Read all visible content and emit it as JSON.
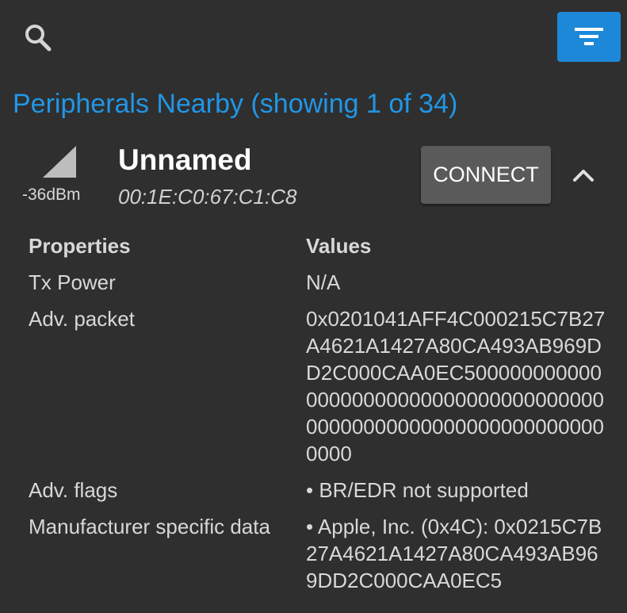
{
  "colors": {
    "background": "#2f2f2f",
    "accent": "#2196e6",
    "filter_button": "#1e88d8",
    "connect_button": "#5a5a5a"
  },
  "toolbar": {
    "search_icon": "search-icon",
    "filter_icon": "filter-icon"
  },
  "section_title": "Peripherals Nearby (showing 1 of 34)",
  "device": {
    "signal_icon": "signal-strength-icon",
    "rssi": "-36dBm",
    "name": "Unnamed",
    "address": "00:1E:C0:67:C1:C8",
    "connect_label": "CONNECT",
    "collapse_icon": "chevron-up-icon"
  },
  "properties": {
    "header_property": "Properties",
    "header_value": "Values",
    "rows": [
      {
        "property": "Tx Power",
        "value": "N/A"
      },
      {
        "property": "Adv. packet",
        "value": "0x0201041AFF4C000215C7B27A4621A1427A80CA493AB969DD2C000CAA0EC50000000000000000000000000000000000000000000000000000000000000000000"
      },
      {
        "property": "Adv. flags",
        "value": "• BR/EDR not supported"
      },
      {
        "property": "Manufacturer specific data",
        "value": "• Apple, Inc. (0x4C): 0x0215C7B27A4621A1427A80CA493AB969DD2C000CAA0EC5"
      }
    ]
  }
}
